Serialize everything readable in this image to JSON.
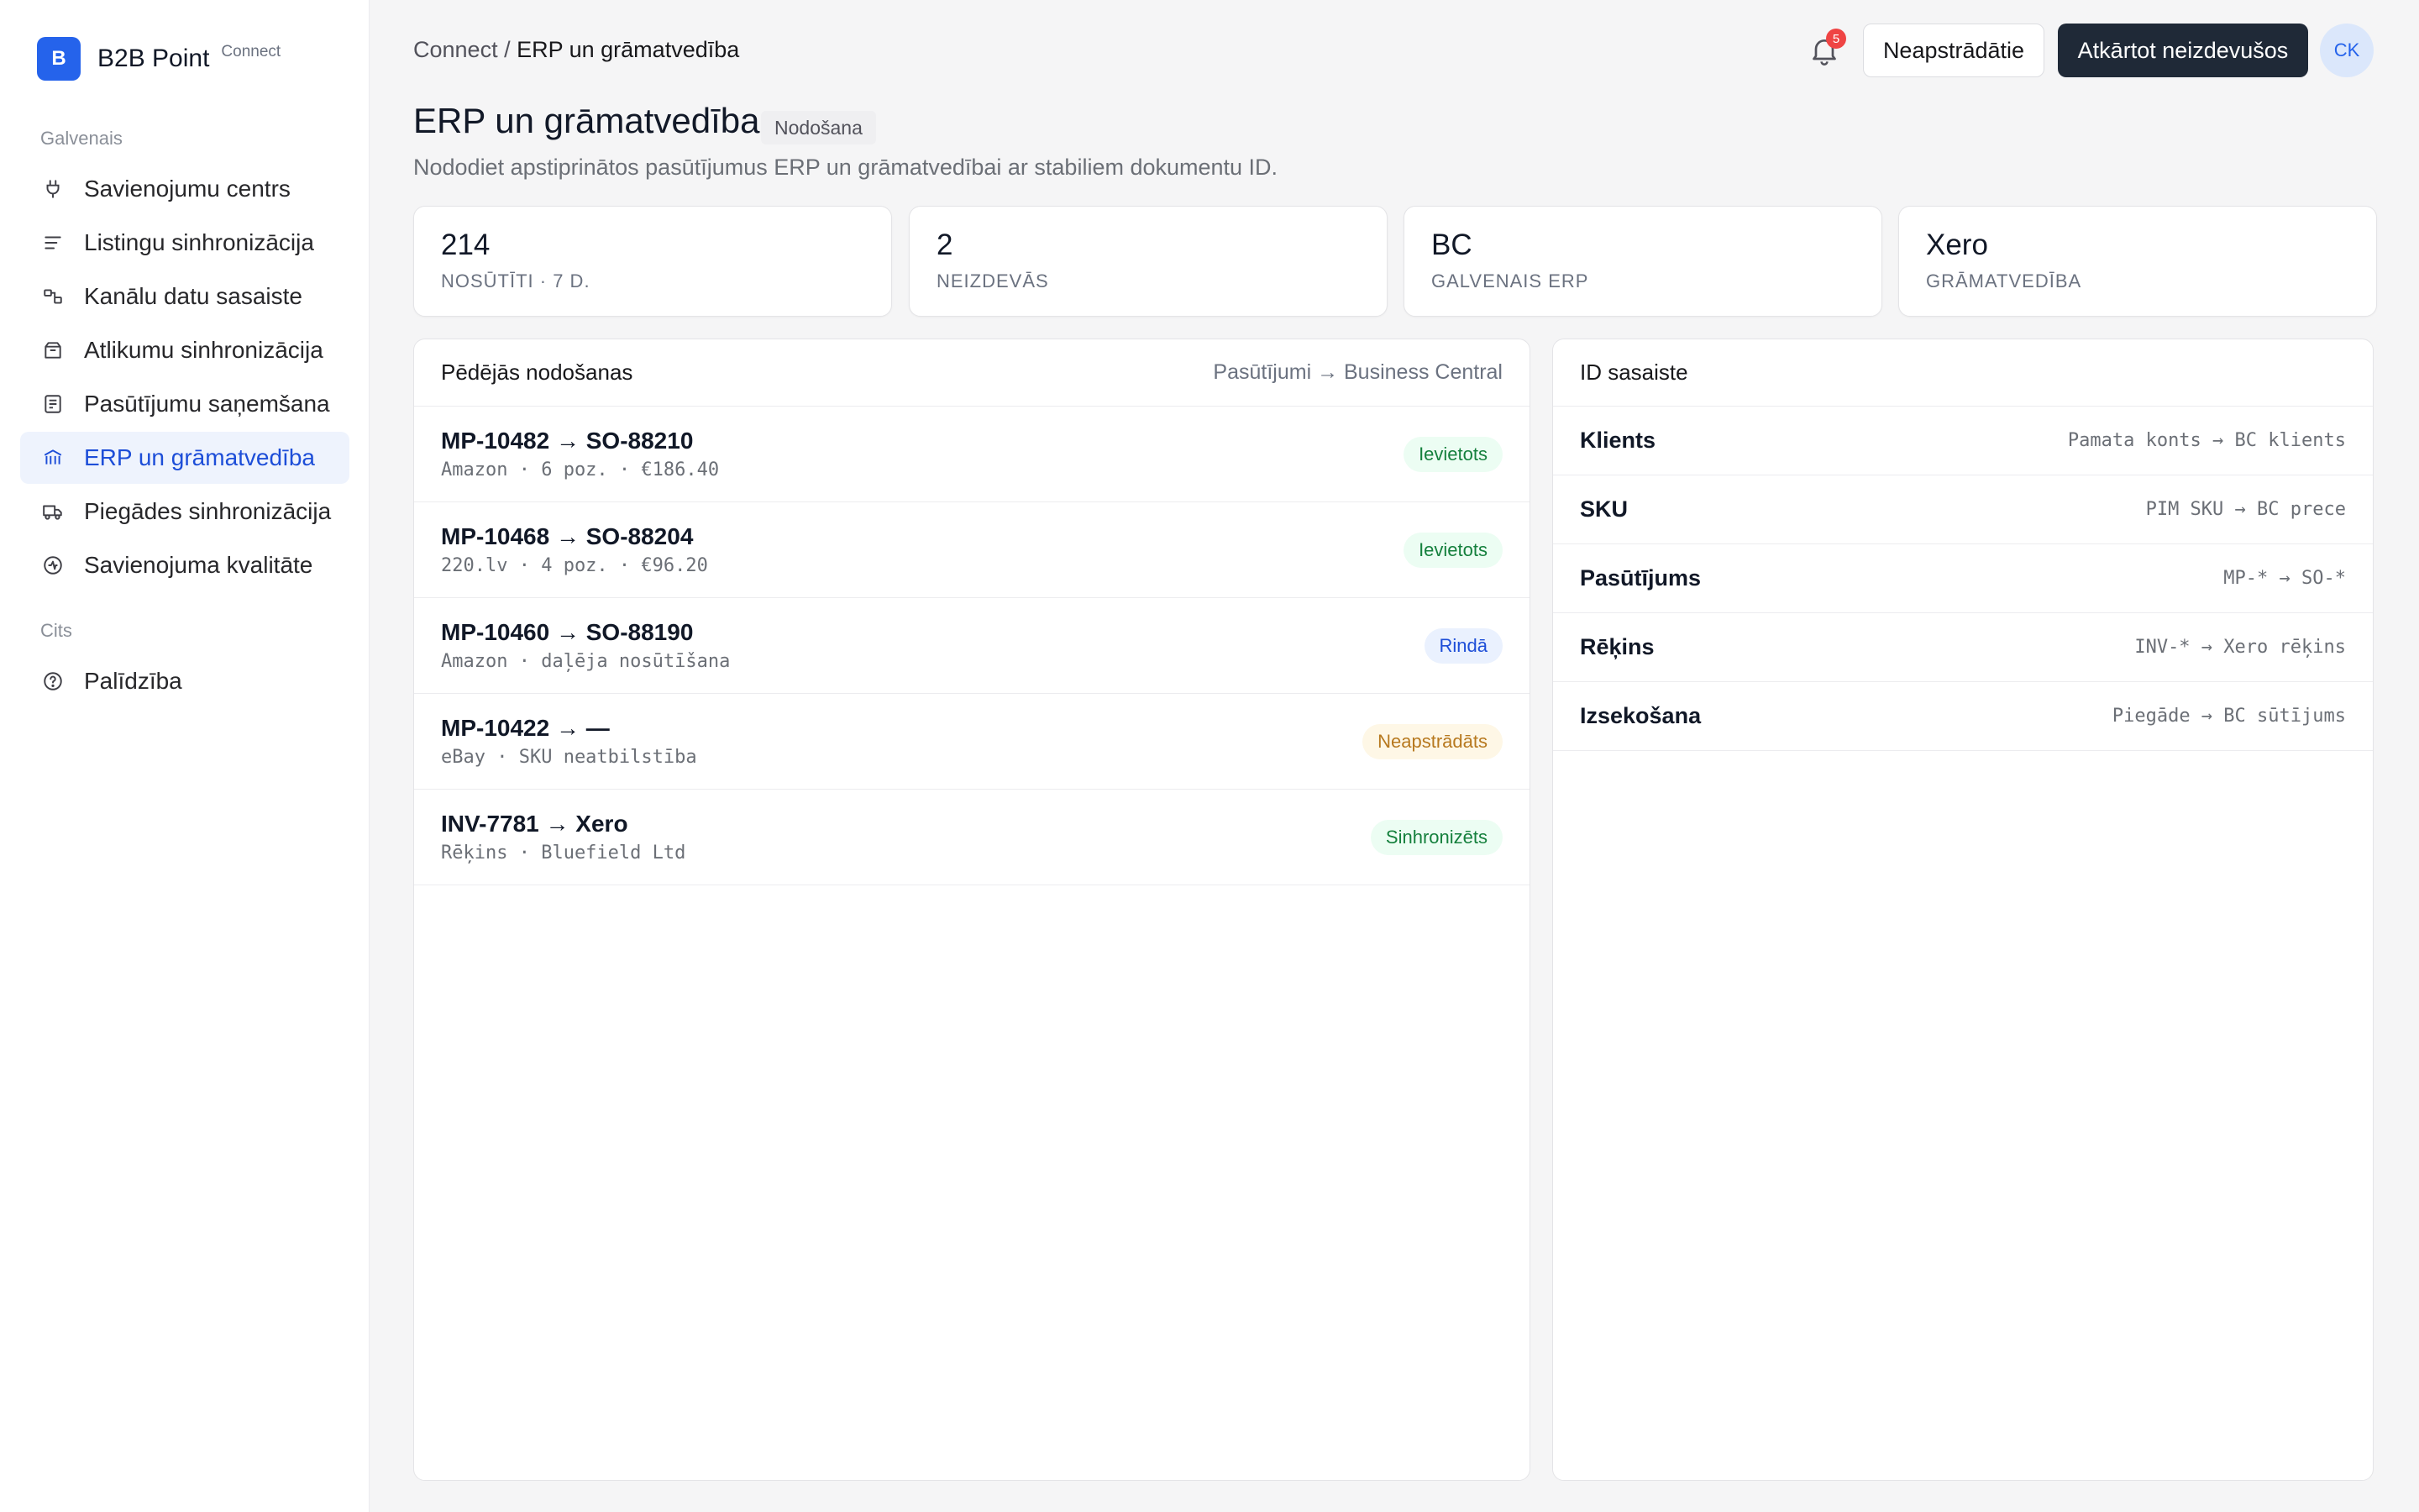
{
  "brand": {
    "logo_letter": "B",
    "name": "B2B Point",
    "sub": "Connect"
  },
  "sidebar": {
    "sections": [
      {
        "label": "Galvenais"
      },
      {
        "label": "Cits"
      }
    ],
    "items": [
      {
        "label": "Savienojumu centrs",
        "icon": "plug-icon"
      },
      {
        "label": "Listingu sinhronizācija",
        "icon": "lines-icon"
      },
      {
        "label": "Kanālu datu sasaiste",
        "icon": "link-map-icon"
      },
      {
        "label": "Atlikumu sinhronizācija",
        "icon": "box-icon"
      },
      {
        "label": "Pasūtījumu saņemšana",
        "icon": "order-icon"
      },
      {
        "label": "ERP un grāmatvedība",
        "icon": "bank-icon",
        "active": true
      },
      {
        "label": "Piegādes sinhronizācija",
        "icon": "truck-icon"
      },
      {
        "label": "Savienojuma kvalitāte",
        "icon": "pulse-icon"
      },
      {
        "label": "Palīdzība",
        "icon": "help-icon"
      }
    ]
  },
  "header": {
    "breadcrumb_root": "Connect /",
    "breadcrumb_current": "ERP un grāmatvedība",
    "notifications": "5",
    "btn_unprocessed": "Neapstrādātie",
    "btn_retry": "Atkārtot neizdevušos",
    "avatar": "CK"
  },
  "page": {
    "title": "ERP un grāmatvedība",
    "badge": "Nodošana",
    "subtitle": "Nododiet apstiprinātos pasūtījumus ERP un grāmatvedībai ar stabiliem dokumentu ID."
  },
  "kpis": [
    {
      "value": "214",
      "label": "NOSŪTĪTI · 7 D."
    },
    {
      "value": "2",
      "label": "NEIZDEVĀS"
    },
    {
      "value": "BC",
      "label": "GALVENAIS ERP"
    },
    {
      "value": "Xero",
      "label": "GRĀMATVEDĪBA"
    }
  ],
  "transfers": {
    "title": "Pēdējās nodošanas",
    "meta": "Pasūtījumi → Business Central",
    "rows": [
      {
        "main": "MP-10482 → SO-88210",
        "sub": "Amazon · 6 poz. · €186.40",
        "status": "Ievietots",
        "tone": "green"
      },
      {
        "main": "MP-10468 → SO-88204",
        "sub": "220.lv · 4 poz. · €96.20",
        "status": "Ievietots",
        "tone": "green"
      },
      {
        "main": "MP-10460 → SO-88190",
        "sub": "Amazon · daļēja nosūtīšana",
        "status": "Rindā",
        "tone": "blue"
      },
      {
        "main": "MP-10422 → —",
        "sub": "eBay · SKU neatbilstība",
        "status": "Neapstrādāts",
        "tone": "amber"
      },
      {
        "main": "INV-7781 → Xero",
        "sub": "Rēķins · Bluefield Ltd",
        "status": "Sinhronizēts",
        "tone": "green"
      }
    ]
  },
  "mapping": {
    "title": "ID sasaiste",
    "rows": [
      {
        "key": "Klients",
        "value": "Pamata konts → BC klients"
      },
      {
        "key": "SKU",
        "value": "PIM SKU → BC prece"
      },
      {
        "key": "Pasūtījums",
        "value": "MP-* → SO-*"
      },
      {
        "key": "Rēķins",
        "value": "INV-* → Xero rēķins"
      },
      {
        "key": "Izsekošana",
        "value": "Piegāde → BC sūtījums"
      }
    ]
  },
  "colors": {
    "accent": "#2563eb",
    "primary_button": "#1f2937",
    "danger": "#ef4444"
  }
}
